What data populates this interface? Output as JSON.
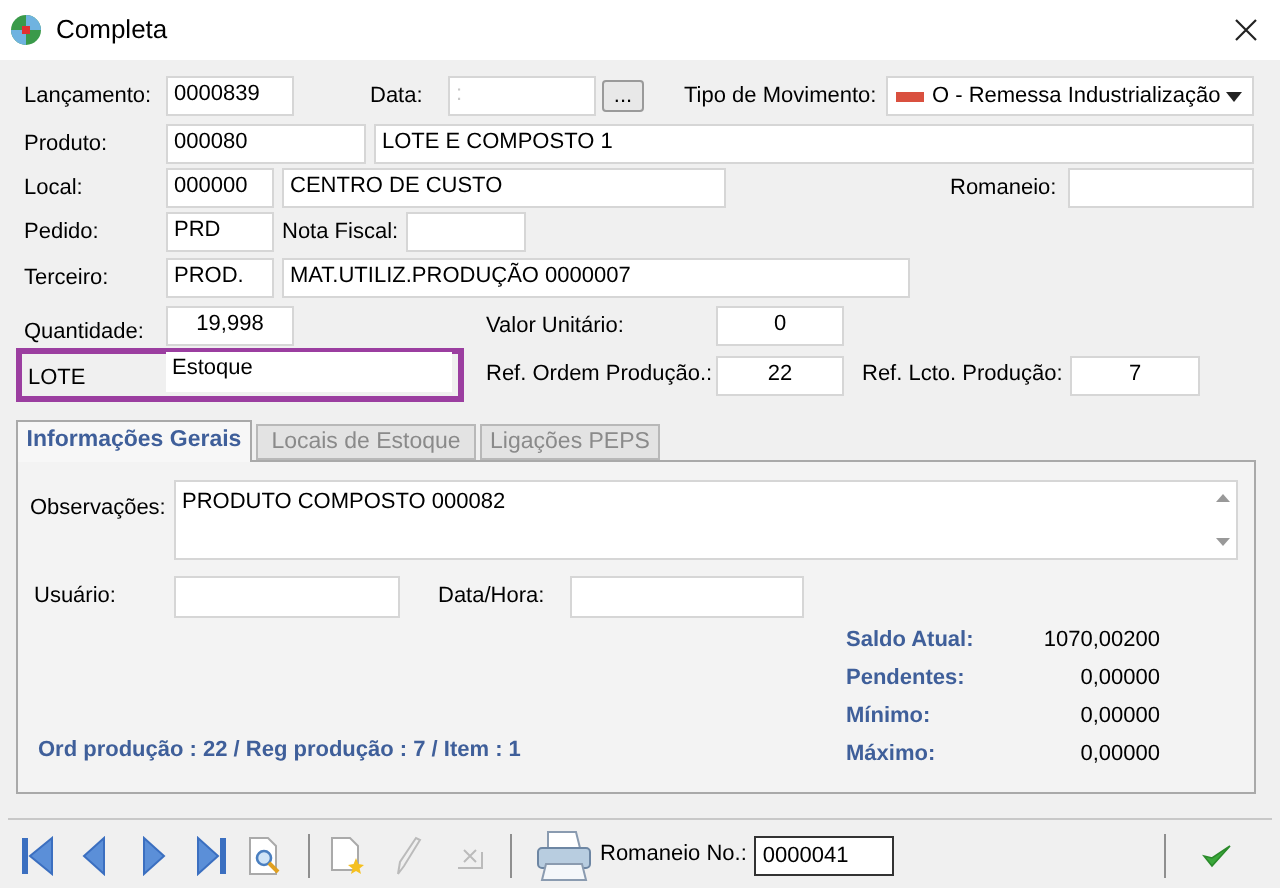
{
  "window": {
    "title": "Completa"
  },
  "lancamento": {
    "label": "Lançamento:",
    "value": "0000839"
  },
  "data": {
    "label": "Data:",
    "placeholder": ":"
  },
  "date_button": {
    "label": "..."
  },
  "tipo_movimento": {
    "label": "Tipo de Movimento:",
    "value": "O - Remessa Industrialização"
  },
  "produto": {
    "label": "Produto:",
    "code": "000080",
    "name": "LOTE E COMPOSTO 1"
  },
  "local": {
    "label": "Local:",
    "code": "000000",
    "name": "CENTRO DE CUSTO"
  },
  "romaneio": {
    "label": "Romaneio:"
  },
  "pedido": {
    "label": "Pedido:",
    "value": "PRD"
  },
  "nota_fiscal": {
    "label": "Nota Fiscal:"
  },
  "terceiro": {
    "label": "Terceiro:",
    "code": "PROD.",
    "name": "MAT.UTILIZ.PRODUÇÃO 0000007"
  },
  "quantidade": {
    "label": "Quantidade:",
    "value": "19,998"
  },
  "valor_unitario": {
    "label": "Valor Unitário:",
    "value": "0"
  },
  "lote": {
    "label": "LOTE",
    "value": "Estoque",
    "highlighted": true
  },
  "ref_ordem": {
    "label": "Ref. Ordem Produção.:",
    "value": "22"
  },
  "ref_lcto": {
    "label": "Ref. Lcto. Produção:",
    "value": "7"
  },
  "tabs": [
    {
      "label": "Informações Gerais",
      "selected": true
    },
    {
      "label": "Locais de Estoque",
      "selected": false
    },
    {
      "label": "Ligações PEPS",
      "selected": false
    }
  ],
  "observacoes": {
    "label": "Observações:",
    "value": "PRODUTO COMPOSTO 000082"
  },
  "usuario": {
    "label": "Usuário:"
  },
  "data_hora": {
    "label": "Data/Hora:"
  },
  "stats": [
    {
      "label": "Saldo Atual:",
      "value": "1070,00200"
    },
    {
      "label": "Pendentes:",
      "value": "0,00000"
    },
    {
      "label": "Mínimo:",
      "value": "0,00000"
    },
    {
      "label": "Máximo:",
      "value": "0,00000"
    }
  ],
  "summary": "Ord produção : 22 / Reg produção : 7 / Item : 1",
  "toolbar": [
    {
      "kind": "first",
      "disabled": false
    },
    {
      "kind": "prev",
      "disabled": false
    },
    {
      "kind": "next",
      "disabled": false
    },
    {
      "kind": "last",
      "disabled": false
    },
    {
      "kind": "preview",
      "disabled": false
    },
    {
      "kind": "separator"
    },
    {
      "kind": "new",
      "disabled": false
    },
    {
      "kind": "edit",
      "disabled": true
    },
    {
      "kind": "cancel",
      "disabled": true
    },
    {
      "kind": "separator"
    },
    {
      "kind": "print",
      "disabled": false
    }
  ],
  "romaneio_no": {
    "label": "Romaneio No.:",
    "value": "0000041"
  }
}
